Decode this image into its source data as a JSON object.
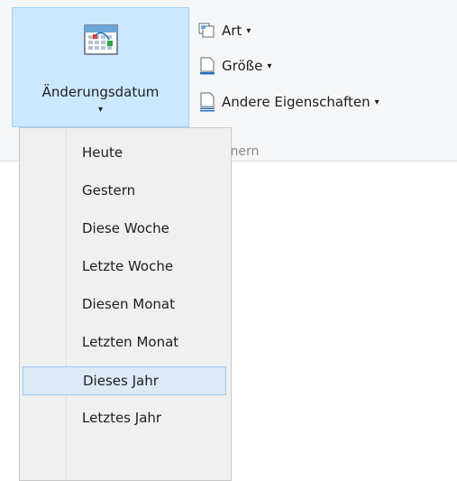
{
  "ribbon": {
    "main_button": {
      "label": "Änderungsdatum",
      "arrow": "▾",
      "icon": "calendar-icon"
    },
    "buttons": [
      {
        "label": "Art",
        "caret": "▾",
        "icon": "kind-icon"
      },
      {
        "label": "Größe",
        "caret": "▾",
        "icon": "size-icon"
      },
      {
        "label": "Andere Eigenschaften",
        "caret": "▾",
        "icon": "properties-icon"
      }
    ],
    "group_label": "einern"
  },
  "menu": {
    "items": [
      {
        "label": "Heute"
      },
      {
        "label": "Gestern"
      },
      {
        "label": "Diese Woche"
      },
      {
        "label": "Letzte Woche"
      },
      {
        "label": "Diesen Monat"
      },
      {
        "label": "Letzten Monat"
      },
      {
        "label": "Dieses Jahr",
        "selected": true
      },
      {
        "label": "Letztes Jahr"
      }
    ]
  },
  "colors": {
    "ribbon_bg": "#f5f6f7",
    "button_hover": "#cce8ff",
    "button_border": "#99d1ff",
    "menu_bg": "#f0f0f0",
    "selected_bg": "#dceaf8",
    "selected_border": "#9cc8f2"
  }
}
